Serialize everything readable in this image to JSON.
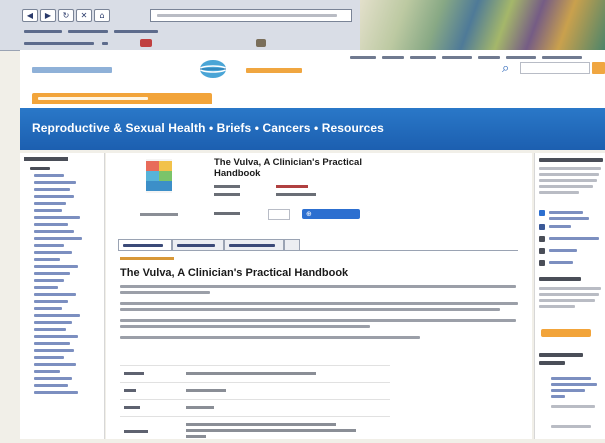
{
  "browser": {
    "nav_icons": [
      "back-icon",
      "forward-icon",
      "reload-icon",
      "stop-icon",
      "home-icon"
    ],
    "nav_glyphs": [
      "◀",
      "▶",
      "↻",
      "✕",
      "⌂"
    ]
  },
  "site": {
    "search_icon": "search-icon",
    "search_glyph": "⌕",
    "colors": {
      "brand_blue": "#1c5fb0",
      "accent_orange": "#f2a43a",
      "link_blue": "#7c8fc0"
    }
  },
  "banner": {
    "title": "Reproductive & Sexual Health • Briefs • Cancers • Resources"
  },
  "product": {
    "title": "The Vulva, A Clinician's Practical Handbook",
    "cart_icon": "cart-icon",
    "cart_glyph": "⊕"
  },
  "tabs": {
    "active_index": 0
  },
  "section": {
    "heading": "The Vulva, A Clinician's Practical Handbook"
  }
}
